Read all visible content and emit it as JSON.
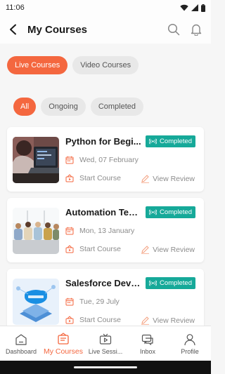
{
  "status_bar": {
    "time": "11:06"
  },
  "header": {
    "title": "My Courses"
  },
  "tabs": [
    {
      "label": "Live Courses",
      "active": true
    },
    {
      "label": "Video Courses",
      "active": false
    }
  ],
  "filters": [
    {
      "label": "All",
      "active": true
    },
    {
      "label": "Ongoing",
      "active": false
    },
    {
      "label": "Completed",
      "active": false
    }
  ],
  "courses": [
    {
      "title": "Python for Begi...",
      "status": "Completed",
      "date": "Wed, 07 February",
      "start_label": "Start Course",
      "review_label": "View Review"
    },
    {
      "title": "Automation Test...",
      "status": "Completed",
      "date": "Mon, 13 January",
      "start_label": "Start Course",
      "review_label": "View Review"
    },
    {
      "title": "Salesforce Devel...",
      "status": "Completed",
      "date": "Tue, 29 July",
      "start_label": "Start Course",
      "review_label": "View Review"
    }
  ],
  "bottom_nav": [
    {
      "label": "Dashboard",
      "icon": "dashboard-icon",
      "active": false
    },
    {
      "label": "My Courses",
      "icon": "my-courses-icon",
      "active": true
    },
    {
      "label": "Live Sessi...",
      "icon": "live-sessions-icon",
      "active": false
    },
    {
      "label": "Inbox",
      "icon": "inbox-icon",
      "active": false
    },
    {
      "label": "Profile",
      "icon": "profile-icon",
      "active": false
    }
  ],
  "colors": {
    "accent": "#f4673f",
    "badge": "#16a999"
  }
}
